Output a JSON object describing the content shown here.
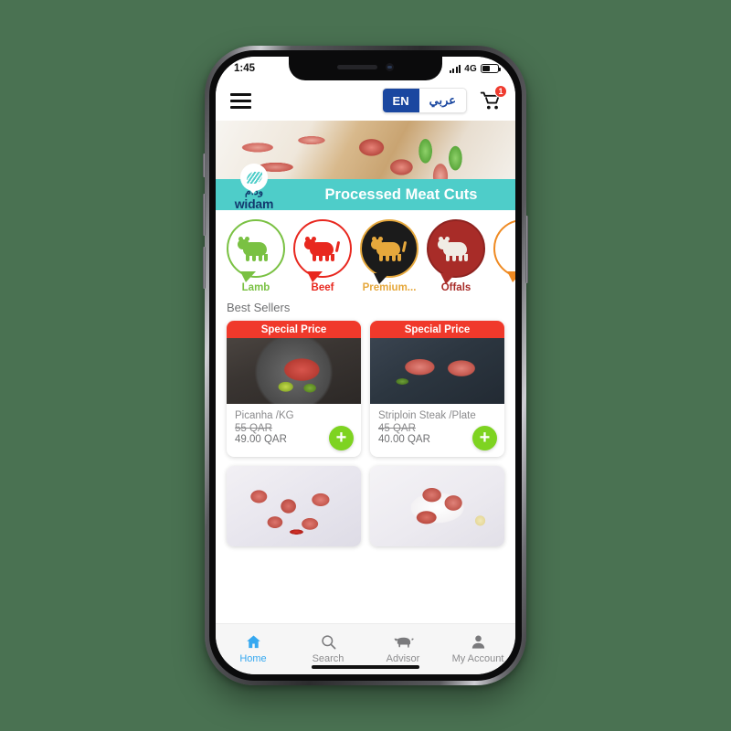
{
  "device": {
    "type": "smartphone-mockup"
  },
  "status_bar": {
    "time": "1:45",
    "network": "4G",
    "signal_icon": "signal-bars-icon",
    "battery_icon": "battery-icon"
  },
  "app_bar": {
    "menu_icon": "hamburger-menu-icon",
    "lang_en": "EN",
    "lang_ar": "عربي",
    "cart_icon": "shopping-cart-icon",
    "cart_count": "1",
    "colors": {
      "lang_active_bg": "#1a47a0",
      "lang_text": "#1a47a0",
      "badge": "#ef3b2f"
    }
  },
  "hero": {
    "title": "Processed Meat Cuts",
    "brand_ar": "ودام",
    "brand_en": "widam",
    "badge_icon": "leaf-badge-icon",
    "band_color": "#4ecdc9"
  },
  "categories": [
    {
      "label": "Lamb",
      "color": "#7ac143",
      "icon": "sheep-icon",
      "filled": false
    },
    {
      "label": "Beef",
      "color": "#e8281f",
      "icon": "cow-icon",
      "filled": false
    },
    {
      "label": "Premium...",
      "color": "#e6a83c",
      "icon": "premium-cow-icon",
      "filled": true,
      "fill": "#1b1b1b"
    },
    {
      "label": "Offals",
      "color": "#a82c28",
      "icon": "offals-icon",
      "filled": true,
      "fill": "#a82c28"
    },
    {
      "label": "",
      "color": "#ef8a22",
      "icon": "chicken-icon",
      "filled": false
    }
  ],
  "sections": {
    "best_sellers": "Best Sellers"
  },
  "products": [
    {
      "badge": "Special Price",
      "name": "Picanha /KG",
      "old_price": "55 QAR",
      "new_price": "49.00 QAR",
      "add_label": "+",
      "image": "picanha-steak-image",
      "image_class": "img-picanha"
    },
    {
      "badge": "Special Price",
      "name": "Striploin Steak /Plate",
      "old_price": "45 QAR",
      "new_price": "40.00 QAR",
      "add_label": "+",
      "image": "striploin-steak-image",
      "image_class": "img-striploin"
    },
    {
      "badge": "",
      "name": "",
      "old_price": "",
      "new_price": "",
      "add_label": "+",
      "image": "beef-cubes-image",
      "image_class": "img-cubes"
    },
    {
      "badge": "",
      "name": "",
      "old_price": "",
      "new_price": "",
      "add_label": "+",
      "image": "lamb-chops-plate-image",
      "image_class": "img-plate"
    }
  ],
  "tabbar": [
    {
      "label": "Home",
      "icon": "home-icon",
      "active": true
    },
    {
      "label": "Search",
      "icon": "search-icon",
      "active": false
    },
    {
      "label": "Advisor",
      "icon": "cow-advisor-icon",
      "active": false
    },
    {
      "label": "My Account",
      "icon": "person-icon",
      "active": false
    }
  ],
  "colors": {
    "page_background": "#4a7252",
    "accent_blue": "#35a8f0",
    "special_price_red": "#f0392b",
    "add_green": "#7ed321",
    "teal": "#4ecdc9"
  }
}
